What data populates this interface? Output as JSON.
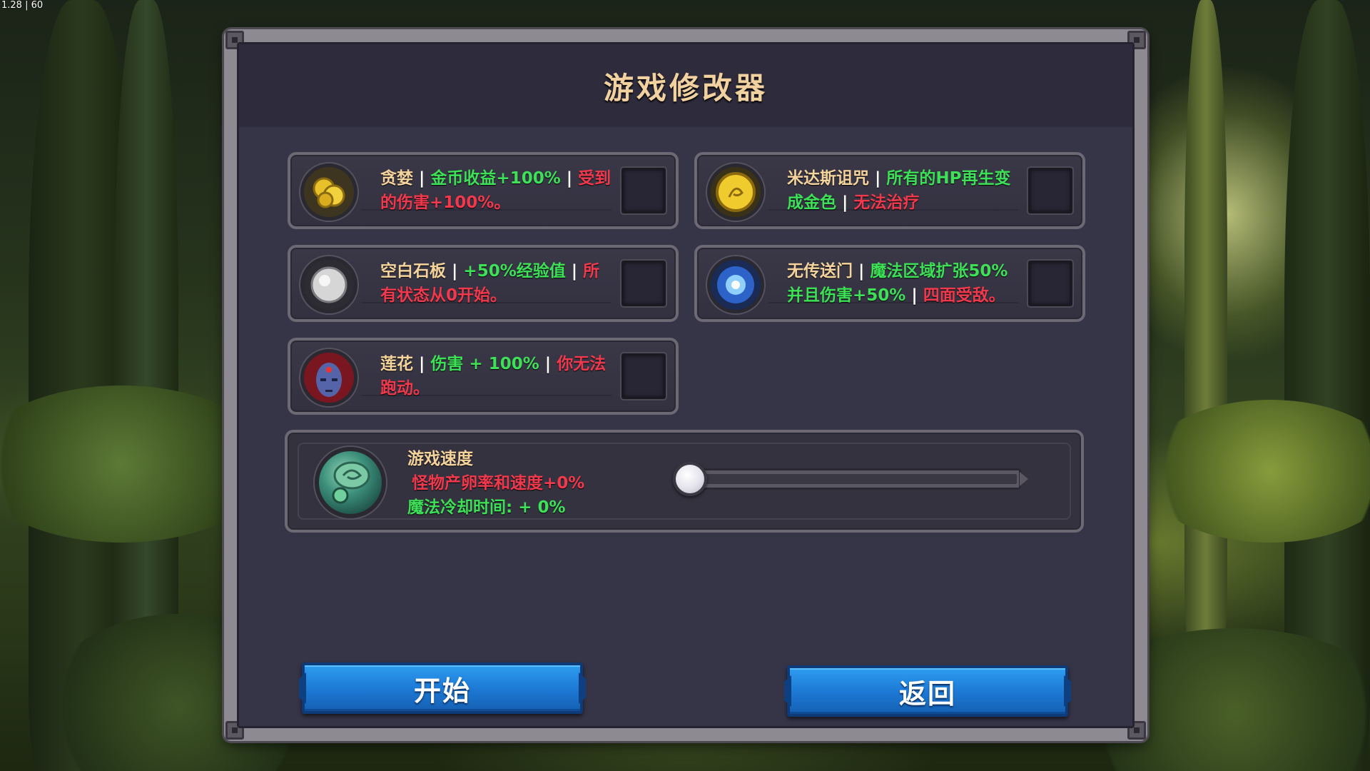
{
  "overlay": {
    "fps": "1.28 | 60"
  },
  "dialog": {
    "title": "游戏修改器"
  },
  "modifiers": [
    {
      "id": "greed",
      "name": "贪婪",
      "effect_good": "金币收益+100%",
      "effect_bad": "受到的伤害+100%。",
      "icon": "gold-coins-icon",
      "checked": false
    },
    {
      "id": "midas",
      "name": "米达斯诅咒",
      "effect_good": "所有的HP再生变成金色",
      "effect_bad": "无法治疗",
      "icon": "gold-medallion-icon",
      "checked": false
    },
    {
      "id": "blank-slate",
      "name": "空白石板",
      "effect_good": "+50%经验值",
      "effect_bad": "所有状态从0开始。",
      "icon": "white-stone-icon",
      "checked": false
    },
    {
      "id": "no-portal",
      "name": "无传送门",
      "effect_good": "魔法区域扩张50%并且伤害+50%",
      "effect_bad": "四面受敌。",
      "icon": "blue-portal-icon",
      "checked": false
    },
    {
      "id": "lotus",
      "name": "莲花",
      "effect_good": "伤害 + 100%",
      "effect_bad": "你无法跑动。",
      "icon": "three-eyed-face-icon",
      "checked": false
    }
  ],
  "speed": {
    "title": "游戏速度",
    "spawn_text": "怪物产卵率和速度+0%",
    "cooldown_text": "魔法冷却时间: + 0%",
    "icon": "green-scroll-hourglass-icon",
    "value_fraction": 0.0
  },
  "buttons": {
    "start": "开始",
    "back": "返回"
  },
  "colors": {
    "name": "#f4d49c",
    "good": "#3ee058",
    "bad": "#f0394c",
    "title": "#f1d19f",
    "button": "#1d7ad6"
  }
}
